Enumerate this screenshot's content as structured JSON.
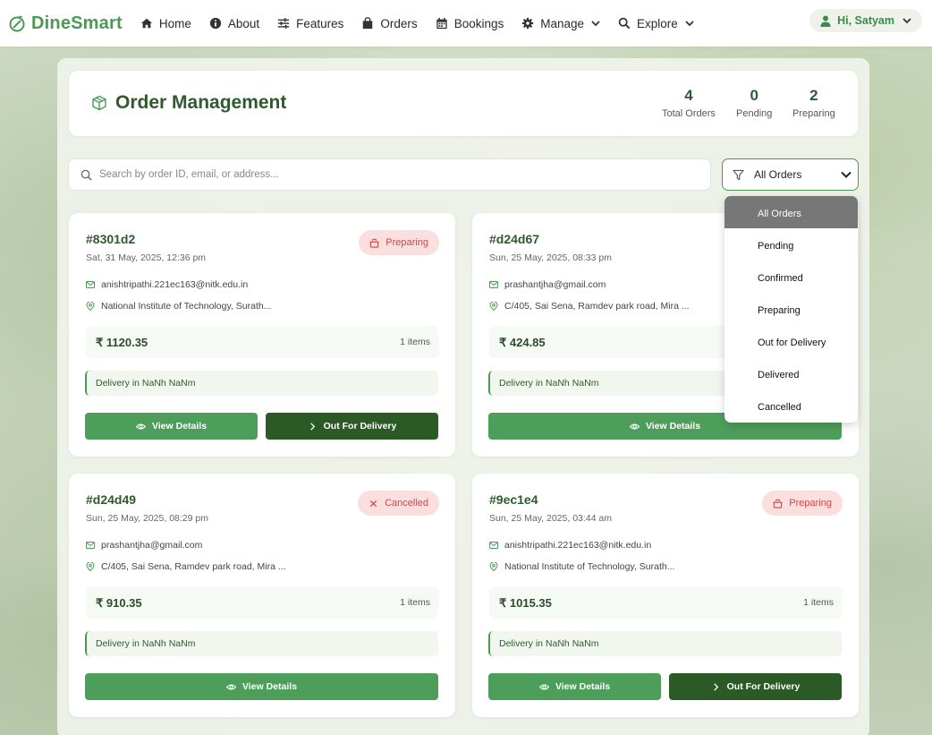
{
  "brand": {
    "name": "DineSmart"
  },
  "nav": {
    "items": [
      {
        "label": "Home",
        "icon": "home-icon"
      },
      {
        "label": "About",
        "icon": "info-icon"
      },
      {
        "label": "Features",
        "icon": "sliders-icon"
      },
      {
        "label": "Orders",
        "icon": "bag-icon"
      },
      {
        "label": "Bookings",
        "icon": "calendar-icon"
      },
      {
        "label": "Manage",
        "icon": "gear-icon",
        "dropdown": true
      },
      {
        "label": "Explore",
        "icon": "search-icon",
        "dropdown": true
      }
    ],
    "user_label": "Hi, Satyam"
  },
  "header": {
    "title": "Order Management",
    "stats": [
      {
        "value": "4",
        "label": "Total Orders"
      },
      {
        "value": "0",
        "label": "Pending"
      },
      {
        "value": "2",
        "label": "Preparing"
      }
    ]
  },
  "search": {
    "placeholder": "Search by order ID, email, or address...",
    "value": ""
  },
  "filter": {
    "selected": "All Orders",
    "options": [
      "All Orders",
      "Pending",
      "Confirmed",
      "Preparing",
      "Out for Delivery",
      "Delivered",
      "Cancelled"
    ]
  },
  "orders": [
    {
      "id": "#8301d2",
      "date": "Sat, 31 May, 2025, 12:36 pm",
      "status": "Preparing",
      "status_icon": "pot-icon",
      "email": "anishtripathi.221ec163@nitk.edu.in",
      "address": "National Institute of Technology, Surath...",
      "price": "₹ 1120.35",
      "items": "1 items",
      "delivery": "Delivery in NaNh NaNm",
      "view_label": "View Details",
      "action_label": "Out For Delivery"
    },
    {
      "id": "#d24d67",
      "date": "Sun, 25 May, 2025, 08:33 pm",
      "status": "",
      "status_icon": "",
      "email": "prashantjha@gmail.com",
      "address": "C/405, Sai Sena, Ramdev park road, Mira ...",
      "price": "₹ 424.85",
      "items": "",
      "delivery": "Delivery in NaNh NaNm",
      "view_label": "View Details",
      "action_label": ""
    },
    {
      "id": "#d24d49",
      "date": "Sun, 25 May, 2025, 08:29 pm",
      "status": "Cancelled",
      "status_icon": "close-icon",
      "email": "prashantjha@gmail.com",
      "address": "C/405, Sai Sena, Ramdev park road, Mira ...",
      "price": "₹ 910.35",
      "items": "1 items",
      "delivery": "Delivery in NaNh NaNm",
      "view_label": "View Details",
      "action_label": ""
    },
    {
      "id": "#9ec1e4",
      "date": "Sun, 25 May, 2025, 03:44 am",
      "status": "Preparing",
      "status_icon": "pot-icon",
      "email": "anishtripathi.221ec163@nitk.edu.in",
      "address": "National Institute of Technology, Surath...",
      "price": "₹ 1015.35",
      "items": "1 items",
      "delivery": "Delivery in NaNh NaNm",
      "view_label": "View Details",
      "action_label": "Out For Delivery"
    }
  ],
  "colors": {
    "brand_green": "#4a9a55",
    "dark_green": "#2b5a26",
    "badge_bg": "#fbdede",
    "badge_text": "#d64545",
    "dropdown_selected": "#777777"
  }
}
